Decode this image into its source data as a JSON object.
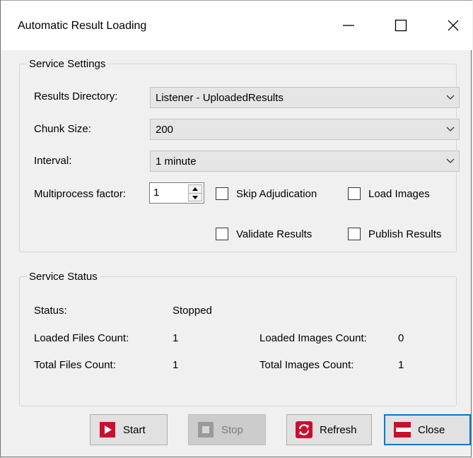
{
  "window": {
    "title": "Automatic Result Loading"
  },
  "settings": {
    "legend": "Service Settings",
    "results_directory": {
      "label": "Results Directory:",
      "value": "Listener - UploadedResults"
    },
    "chunk_size": {
      "label": "Chunk Size:",
      "value": "200"
    },
    "interval": {
      "label": "Interval:",
      "value": "1 minute"
    },
    "multiprocess": {
      "label": "Multiprocess factor:",
      "value": "1"
    },
    "skip_adjudication": {
      "label": "Skip Adjudication",
      "checked": false
    },
    "load_images": {
      "label": "Load Images",
      "checked": false
    },
    "validate_results": {
      "label": "Validate Results",
      "checked": false
    },
    "publish_results": {
      "label": "Publish Results",
      "checked": false
    }
  },
  "status": {
    "legend": "Service Status",
    "status_label": "Status:",
    "status_value": "Stopped",
    "loaded_files_label": "Loaded Files Count:",
    "loaded_files_value": "1",
    "loaded_images_label": "Loaded Images Count:",
    "loaded_images_value": "0",
    "total_files_label": "Total Files Count:",
    "total_files_value": "1",
    "total_images_label": "Total Images Count:",
    "total_images_value": "1"
  },
  "buttons": {
    "start": "Start",
    "stop": "Stop",
    "refresh": "Refresh",
    "close": "Close"
  },
  "colors": {
    "accent": "#0078d7",
    "start_icon": "#c8102e",
    "refresh_icon": "#c8102e",
    "close_icon": "#c8102e"
  }
}
